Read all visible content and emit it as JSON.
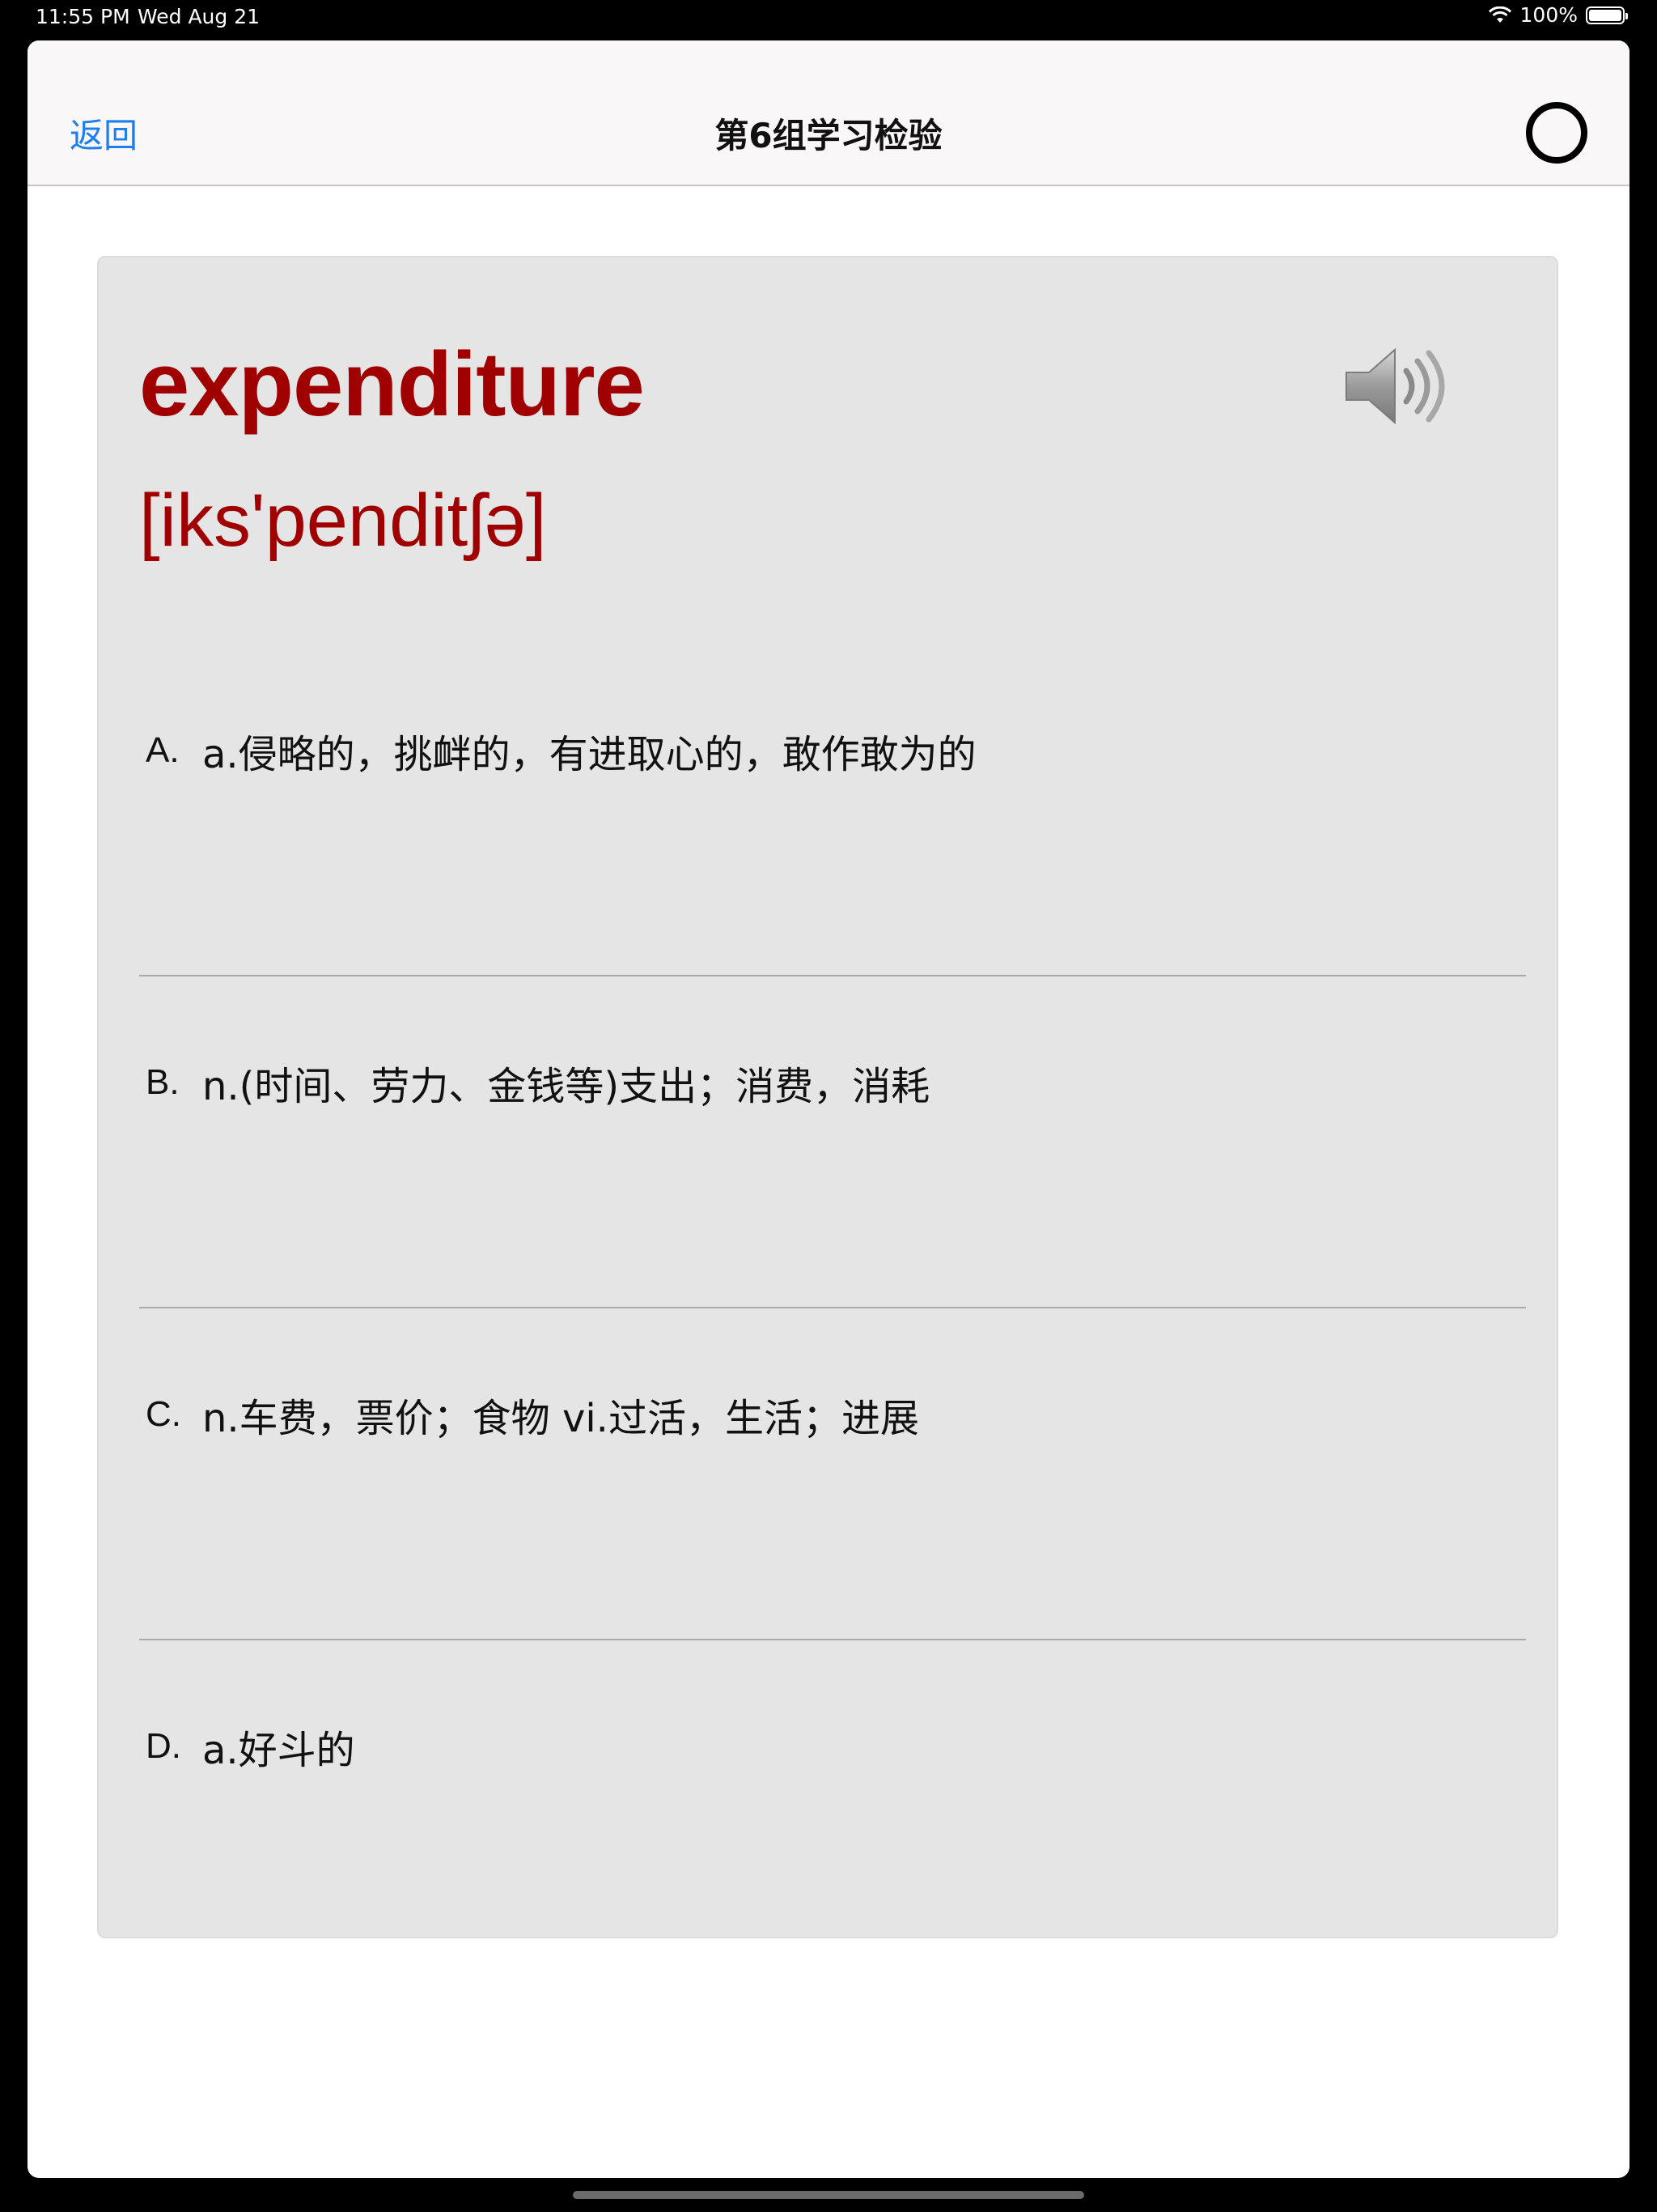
{
  "status_bar": {
    "time": "11:55 PM",
    "date": "Wed Aug 21",
    "battery": "100%",
    "icons": [
      "wifi-icon",
      "battery-icon"
    ]
  },
  "nav": {
    "back_label": "返回",
    "title": "第6组学习检验",
    "right_icon": "circle-icon"
  },
  "quiz": {
    "word": "expenditure",
    "phonetic": "[iks'penditʃə]",
    "speaker_icon": "speaker-icon",
    "word_color": "#a00000",
    "options": [
      {
        "letter": "A.",
        "text": "a.侵略的，挑衅的，有进取心的，敢作敢为的"
      },
      {
        "letter": "B.",
        "text": "n.(时间、劳力、金钱等)支出；消费，消耗"
      },
      {
        "letter": "C.",
        "text": "n.车费，票价；食物 vi.过活，生活；进展"
      },
      {
        "letter": "D.",
        "text": "a.好斗的"
      }
    ]
  }
}
